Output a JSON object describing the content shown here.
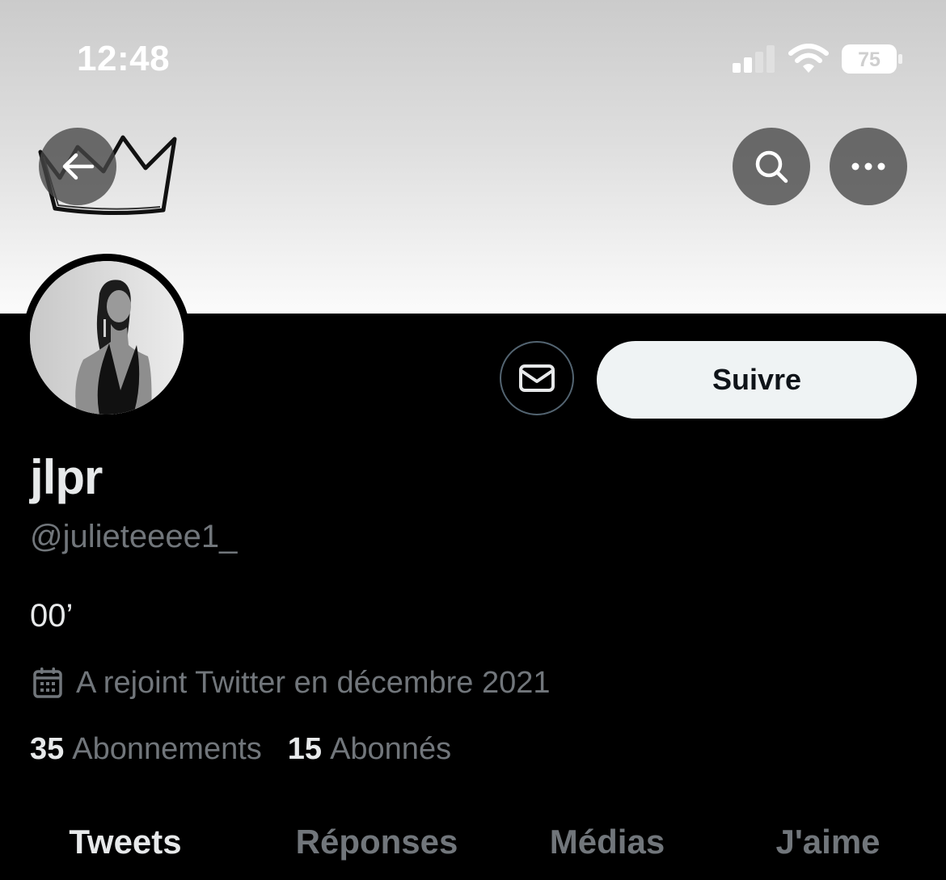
{
  "status_bar": {
    "time": "12:48",
    "battery_level": "75",
    "icons": [
      "signal-icon",
      "wifi-icon",
      "battery-icon"
    ]
  },
  "header": {
    "icons": [
      "back-arrow-icon",
      "search-icon",
      "more-icon"
    ]
  },
  "profile": {
    "display_name": "jlpr",
    "handle": "@julieteeee1_",
    "bio": "00’",
    "joined": "A rejoint Twitter en décembre 2021",
    "following_count": "35",
    "following_label": "Abonnements",
    "followers_count": "15",
    "followers_label": "Abonnés"
  },
  "actions": {
    "follow_label": "Suivre",
    "message_icon": "mail-icon"
  },
  "tabs": [
    {
      "label": "Tweets",
      "active": true
    },
    {
      "label": "Réponses",
      "active": false
    },
    {
      "label": "Médias",
      "active": false
    },
    {
      "label": "J'aime",
      "active": false
    }
  ],
  "colors": {
    "background": "#000000",
    "primary_text": "#e7e9ea",
    "secondary_text": "#71767b",
    "follow_button_bg": "#eff3f4",
    "follow_button_text": "#0f1419"
  }
}
